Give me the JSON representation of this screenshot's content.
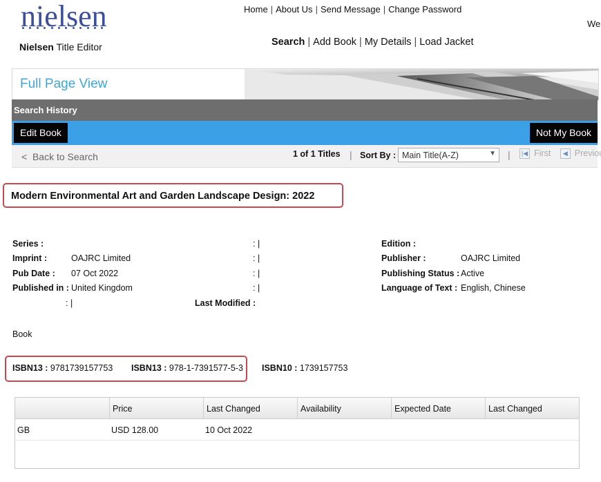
{
  "brand": {
    "logo_text": "nielsen",
    "app_bold": "Nielsen",
    "app_rest": " Title Editor"
  },
  "top_nav": [
    "Home",
    "About Us",
    "Send Message",
    "Change Password"
  ],
  "welcome": "We",
  "main_nav": [
    "Search",
    "Add Book",
    "My Details",
    "Load Jacket"
  ],
  "banner": {
    "title": "Full Page View"
  },
  "search_history": "Search History",
  "actions": {
    "edit": "Edit Book",
    "not_mine": "Not My Book"
  },
  "results_bar": {
    "back": "Back to Search",
    "count": "1 of 1 Titles",
    "sort_label": "Sort By :",
    "sort_value": "Main Title(A-Z)",
    "first": "First",
    "previous": "Previou"
  },
  "book": {
    "title": "Modern Environmental Art and Garden Landscape Design: 2022",
    "left": [
      {
        "label": "Series :",
        "value": ""
      },
      {
        "label": "Imprint :",
        "value": "OAJRC Limited"
      },
      {
        "label": "Pub Date :",
        "value": "07 Oct 2022"
      },
      {
        "label": "Published in :",
        "value": "United Kingdom"
      }
    ],
    "right": [
      {
        "label": "Edition :",
        "value": ""
      },
      {
        "label": "Publisher :",
        "value": "OAJRC Limited"
      },
      {
        "label": "Publishing Status :",
        "value": "Active"
      },
      {
        "label": "Language of Text :",
        "value": "English, Chinese"
      }
    ],
    "last_modified_label": "Last Modified :",
    "format": "Book",
    "isbn13_label": "ISBN13 :",
    "isbn13_value": "9781739157753",
    "isbn13h_label": "ISBN13 :",
    "isbn13h_value": "978-1-7391577-5-3",
    "isbn10_label": "ISBN10 :",
    "isbn10_value": "1739157753"
  },
  "price_table": {
    "headers": [
      "",
      "Price",
      "Last Changed",
      "Availability",
      "Expected Date",
      "Last Changed"
    ],
    "rows": [
      [
        "GB",
        "USD 128.00",
        "10 Oct 2022",
        "",
        "",
        ""
      ]
    ]
  },
  "colors": {
    "accent_blue": "#3ca0e6",
    "title_blue": "#3ea6d9",
    "highlight_red": "#c9484f",
    "logo_blue": "#3b4f9a"
  }
}
